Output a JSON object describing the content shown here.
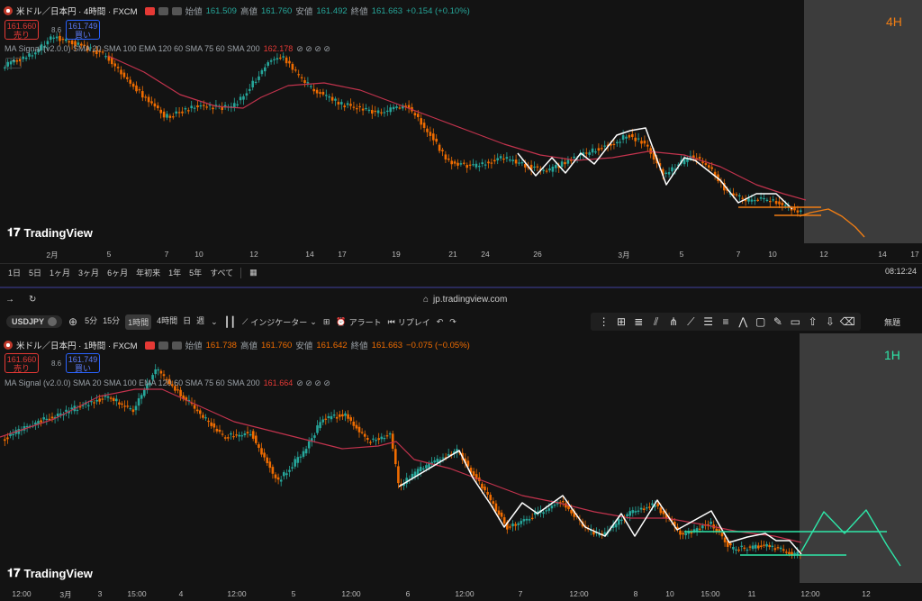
{
  "top": {
    "symbol_title": "米ドル／日本円 · 4時間 · FXCM",
    "ohlc": {
      "open_label": "始値",
      "open": "161.509",
      "high_label": "高値",
      "high": "161.760",
      "low_label": "安値",
      "low": "161.492",
      "close_label": "終値",
      "close": "161.663",
      "change": "+0.154 (+0.10%)"
    },
    "sell": {
      "price": "161.660",
      "label": "売り"
    },
    "buy": {
      "price": "161.749",
      "label": "買い"
    },
    "spread": "8.6",
    "indicator_row": "MA Signal (v2.0.0) SMA 20 SMA 100 EMA 120 60 SMA 75 60 SMA 200",
    "indicator_value": "162.178",
    "indicator_icons": "⊘ ⊘ ⊘ ⊘",
    "timeframe_label": "4H",
    "logo_text": "TradingView",
    "xaxis_labels": [
      "2月",
      "5",
      "7",
      "10",
      "12",
      "14",
      "17",
      "19",
      "21",
      "24",
      "26",
      "3月",
      "5",
      "7",
      "10",
      "12",
      "14",
      "17"
    ],
    "range_buttons": [
      "1日",
      "5日",
      "1ヶ月",
      "3ヶ月",
      "6ヶ月",
      "年初来",
      "1年",
      "5年",
      "すべて"
    ],
    "clock": "08:12:24"
  },
  "bottom": {
    "url": "jp.tradingview.com",
    "symbol_code": "USDJPY",
    "intervals": [
      "5分",
      "15分",
      "1時間",
      "4時間",
      "日",
      "週"
    ],
    "active_interval": "1時間",
    "indicators_label": "インジケーター",
    "alert_label": "アラート",
    "replay_label": "リプレイ",
    "mute_label": "無題",
    "symbol_title": "米ドル／日本円 · 1時間 · FXCM",
    "ohlc": {
      "open_label": "始値",
      "open": "161.738",
      "high_label": "高値",
      "high": "161.760",
      "low_label": "安値",
      "low": "161.642",
      "close_label": "終値",
      "close": "161.663",
      "change": "−0.075 (−0.05%)"
    },
    "sell": {
      "price": "161.660",
      "label": "売り"
    },
    "buy": {
      "price": "161.749",
      "label": "買い"
    },
    "spread": "8.6",
    "indicator_row": "MA Signal (v2.0.0) SMA 20 SMA 100 EMA 120 60 SMA 75 60 SMA 200",
    "indicator_value": "161.664",
    "indicator_icons": "⊘ ⊘ ⊘ ⊘",
    "timeframe_label": "1H",
    "logo_text": "TradingView",
    "xaxis_labels": [
      "12:00",
      "3月",
      "3",
      "15:00",
      "4",
      "12:00",
      "5",
      "12:00",
      "6",
      "12:00",
      "7",
      "12:00",
      "8",
      "10",
      "15:00",
      "11",
      "12:00",
      "12"
    ]
  },
  "colors": {
    "up": "#26a69a",
    "down": "#ef6c00",
    "ma": "#c2334d",
    "projection_top": "#ef7d14",
    "projection_bottom": "#2ee6a8",
    "timeframe_top": "#ef7d14",
    "timeframe_bottom": "#2ee6a8"
  }
}
